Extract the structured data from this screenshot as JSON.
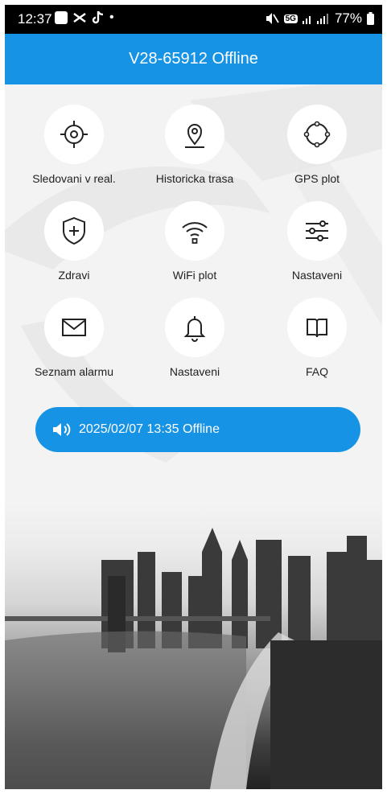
{
  "status_bar": {
    "time": "12:37",
    "battery": "77%",
    "network": "5G"
  },
  "header": {
    "title": "V28-65912 Offline"
  },
  "grid": [
    {
      "label": "Sledovani v real.",
      "icon": "crosshair-icon"
    },
    {
      "label": "Historicka trasa",
      "icon": "location-pin-icon"
    },
    {
      "label": "GPS plot",
      "icon": "geofence-icon"
    },
    {
      "label": "Zdravi",
      "icon": "shield-plus-icon"
    },
    {
      "label": "WiFi plot",
      "icon": "wifi-icon"
    },
    {
      "label": "Nastaveni",
      "icon": "sliders-icon"
    },
    {
      "label": "Seznam alarmu",
      "icon": "envelope-icon"
    },
    {
      "label": "Nastaveni",
      "icon": "bell-icon"
    },
    {
      "label": "FAQ",
      "icon": "book-icon"
    }
  ],
  "banner": {
    "text": "2025/02/07 13:35 Offline",
    "icon": "speaker-icon"
  },
  "colors": {
    "accent": "#1793e6",
    "background": "#f3f3f3"
  }
}
